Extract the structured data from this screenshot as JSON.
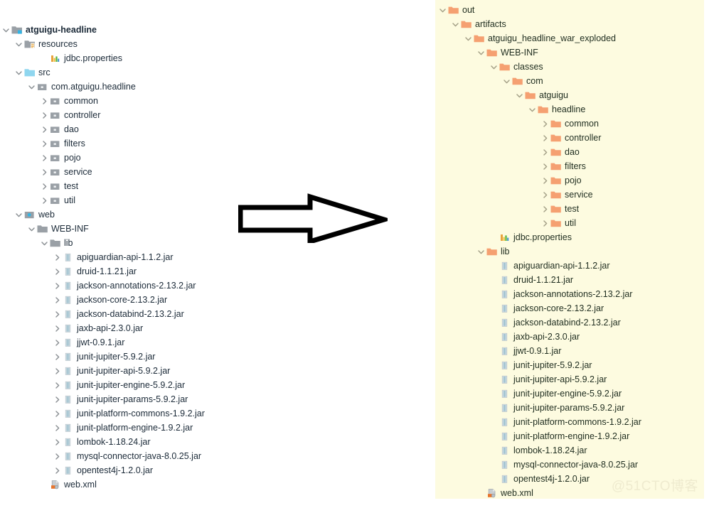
{
  "arrow": {
    "name": "right-arrow",
    "direction": "right",
    "color": "#000000"
  },
  "watermark": {
    "text": "@51CTO博客"
  },
  "left_tree": {
    "background": "#ffffff",
    "nodes": [
      {
        "label": "atguigu-headline",
        "depth": 0,
        "twisty": "expanded",
        "icon": "folder-module-gray",
        "bold": true
      },
      {
        "label": "resources",
        "depth": 1,
        "twisty": "expanded",
        "icon": "folder-resources-gray",
        "bold": false
      },
      {
        "label": "jdbc.properties",
        "depth": 3,
        "twisty": "none",
        "icon": "properties-file",
        "bold": false
      },
      {
        "label": "src",
        "depth": 1,
        "twisty": "expanded",
        "icon": "folder-source-blue",
        "bold": false
      },
      {
        "label": "com.atguigu.headline",
        "depth": 2,
        "twisty": "expanded",
        "icon": "package-gray",
        "bold": false
      },
      {
        "label": "common",
        "depth": 3,
        "twisty": "collapsed",
        "icon": "package-gray",
        "bold": false
      },
      {
        "label": "controller",
        "depth": 3,
        "twisty": "collapsed",
        "icon": "package-gray",
        "bold": false
      },
      {
        "label": "dao",
        "depth": 3,
        "twisty": "collapsed",
        "icon": "package-gray",
        "bold": false
      },
      {
        "label": "filters",
        "depth": 3,
        "twisty": "collapsed",
        "icon": "package-gray",
        "bold": false
      },
      {
        "label": "pojo",
        "depth": 3,
        "twisty": "collapsed",
        "icon": "package-gray",
        "bold": false
      },
      {
        "label": "service",
        "depth": 3,
        "twisty": "collapsed",
        "icon": "package-gray",
        "bold": false
      },
      {
        "label": "test",
        "depth": 3,
        "twisty": "collapsed",
        "icon": "package-gray",
        "bold": false
      },
      {
        "label": "util",
        "depth": 3,
        "twisty": "collapsed",
        "icon": "package-gray",
        "bold": false
      },
      {
        "label": "web",
        "depth": 1,
        "twisty": "expanded",
        "icon": "folder-web-blue",
        "bold": false
      },
      {
        "label": "WEB-INF",
        "depth": 2,
        "twisty": "expanded",
        "icon": "folder-gray",
        "bold": false
      },
      {
        "label": "lib",
        "depth": 3,
        "twisty": "expanded",
        "icon": "folder-gray",
        "bold": false
      },
      {
        "label": "apiguardian-api-1.1.2.jar",
        "depth": 4,
        "twisty": "collapsed",
        "icon": "jar-file",
        "bold": false
      },
      {
        "label": "druid-1.1.21.jar",
        "depth": 4,
        "twisty": "collapsed",
        "icon": "jar-file",
        "bold": false
      },
      {
        "label": "jackson-annotations-2.13.2.jar",
        "depth": 4,
        "twisty": "collapsed",
        "icon": "jar-file",
        "bold": false
      },
      {
        "label": "jackson-core-2.13.2.jar",
        "depth": 4,
        "twisty": "collapsed",
        "icon": "jar-file",
        "bold": false
      },
      {
        "label": "jackson-databind-2.13.2.jar",
        "depth": 4,
        "twisty": "collapsed",
        "icon": "jar-file",
        "bold": false
      },
      {
        "label": "jaxb-api-2.3.0.jar",
        "depth": 4,
        "twisty": "collapsed",
        "icon": "jar-file",
        "bold": false
      },
      {
        "label": "jjwt-0.9.1.jar",
        "depth": 4,
        "twisty": "collapsed",
        "icon": "jar-file",
        "bold": false
      },
      {
        "label": "junit-jupiter-5.9.2.jar",
        "depth": 4,
        "twisty": "collapsed",
        "icon": "jar-file",
        "bold": false
      },
      {
        "label": "junit-jupiter-api-5.9.2.jar",
        "depth": 4,
        "twisty": "collapsed",
        "icon": "jar-file",
        "bold": false
      },
      {
        "label": "junit-jupiter-engine-5.9.2.jar",
        "depth": 4,
        "twisty": "collapsed",
        "icon": "jar-file",
        "bold": false
      },
      {
        "label": "junit-jupiter-params-5.9.2.jar",
        "depth": 4,
        "twisty": "collapsed",
        "icon": "jar-file",
        "bold": false
      },
      {
        "label": "junit-platform-commons-1.9.2.jar",
        "depth": 4,
        "twisty": "collapsed",
        "icon": "jar-file",
        "bold": false
      },
      {
        "label": "junit-platform-engine-1.9.2.jar",
        "depth": 4,
        "twisty": "collapsed",
        "icon": "jar-file",
        "bold": false
      },
      {
        "label": "lombok-1.18.24.jar",
        "depth": 4,
        "twisty": "collapsed",
        "icon": "jar-file",
        "bold": false
      },
      {
        "label": "mysql-connector-java-8.0.25.jar",
        "depth": 4,
        "twisty": "collapsed",
        "icon": "jar-file",
        "bold": false
      },
      {
        "label": "opentest4j-1.2.0.jar",
        "depth": 4,
        "twisty": "collapsed",
        "icon": "jar-file",
        "bold": false
      },
      {
        "label": "web.xml",
        "depth": 3,
        "twisty": "none",
        "icon": "xml-file",
        "bold": false
      }
    ]
  },
  "right_tree": {
    "background": "#fdfbe0",
    "nodes": [
      {
        "label": "out",
        "depth": 0,
        "twisty": "expanded",
        "icon": "folder-orange"
      },
      {
        "label": "artifacts",
        "depth": 1,
        "twisty": "expanded",
        "icon": "folder-orange"
      },
      {
        "label": "atguigu_headline_war_exploded",
        "depth": 2,
        "twisty": "expanded",
        "icon": "folder-orange"
      },
      {
        "label": "WEB-INF",
        "depth": 3,
        "twisty": "expanded",
        "icon": "folder-orange"
      },
      {
        "label": "classes",
        "depth": 4,
        "twisty": "expanded",
        "icon": "folder-orange"
      },
      {
        "label": "com",
        "depth": 5,
        "twisty": "expanded",
        "icon": "folder-orange"
      },
      {
        "label": "atguigu",
        "depth": 6,
        "twisty": "expanded",
        "icon": "folder-orange"
      },
      {
        "label": "headline",
        "depth": 7,
        "twisty": "expanded",
        "icon": "folder-orange"
      },
      {
        "label": "common",
        "depth": 8,
        "twisty": "collapsed",
        "icon": "folder-orange"
      },
      {
        "label": "controller",
        "depth": 8,
        "twisty": "collapsed",
        "icon": "folder-orange"
      },
      {
        "label": "dao",
        "depth": 8,
        "twisty": "collapsed",
        "icon": "folder-orange"
      },
      {
        "label": "filters",
        "depth": 8,
        "twisty": "collapsed",
        "icon": "folder-orange"
      },
      {
        "label": "pojo",
        "depth": 8,
        "twisty": "collapsed",
        "icon": "folder-orange"
      },
      {
        "label": "service",
        "depth": 8,
        "twisty": "collapsed",
        "icon": "folder-orange"
      },
      {
        "label": "test",
        "depth": 8,
        "twisty": "collapsed",
        "icon": "folder-orange"
      },
      {
        "label": "util",
        "depth": 8,
        "twisty": "collapsed",
        "icon": "folder-orange"
      },
      {
        "label": "jdbc.properties",
        "depth": 4,
        "twisty": "none",
        "icon": "properties-file"
      },
      {
        "label": "lib",
        "depth": 3,
        "twisty": "expanded",
        "icon": "folder-orange"
      },
      {
        "label": "apiguardian-api-1.1.2.jar",
        "depth": 4,
        "twisty": "none",
        "icon": "jar-file"
      },
      {
        "label": "druid-1.1.21.jar",
        "depth": 4,
        "twisty": "none",
        "icon": "jar-file"
      },
      {
        "label": "jackson-annotations-2.13.2.jar",
        "depth": 4,
        "twisty": "none",
        "icon": "jar-file"
      },
      {
        "label": "jackson-core-2.13.2.jar",
        "depth": 4,
        "twisty": "none",
        "icon": "jar-file"
      },
      {
        "label": "jackson-databind-2.13.2.jar",
        "depth": 4,
        "twisty": "none",
        "icon": "jar-file"
      },
      {
        "label": "jaxb-api-2.3.0.jar",
        "depth": 4,
        "twisty": "none",
        "icon": "jar-file"
      },
      {
        "label": "jjwt-0.9.1.jar",
        "depth": 4,
        "twisty": "none",
        "icon": "jar-file"
      },
      {
        "label": "junit-jupiter-5.9.2.jar",
        "depth": 4,
        "twisty": "none",
        "icon": "jar-file"
      },
      {
        "label": "junit-jupiter-api-5.9.2.jar",
        "depth": 4,
        "twisty": "none",
        "icon": "jar-file"
      },
      {
        "label": "junit-jupiter-engine-5.9.2.jar",
        "depth": 4,
        "twisty": "none",
        "icon": "jar-file"
      },
      {
        "label": "junit-jupiter-params-5.9.2.jar",
        "depth": 4,
        "twisty": "none",
        "icon": "jar-file"
      },
      {
        "label": "junit-platform-commons-1.9.2.jar",
        "depth": 4,
        "twisty": "none",
        "icon": "jar-file"
      },
      {
        "label": "junit-platform-engine-1.9.2.jar",
        "depth": 4,
        "twisty": "none",
        "icon": "jar-file"
      },
      {
        "label": "lombok-1.18.24.jar",
        "depth": 4,
        "twisty": "none",
        "icon": "jar-file"
      },
      {
        "label": "mysql-connector-java-8.0.25.jar",
        "depth": 4,
        "twisty": "none",
        "icon": "jar-file"
      },
      {
        "label": "opentest4j-1.2.0.jar",
        "depth": 4,
        "twisty": "none",
        "icon": "jar-file"
      },
      {
        "label": "web.xml",
        "depth": 3,
        "twisty": "none",
        "icon": "xml-file"
      }
    ]
  }
}
